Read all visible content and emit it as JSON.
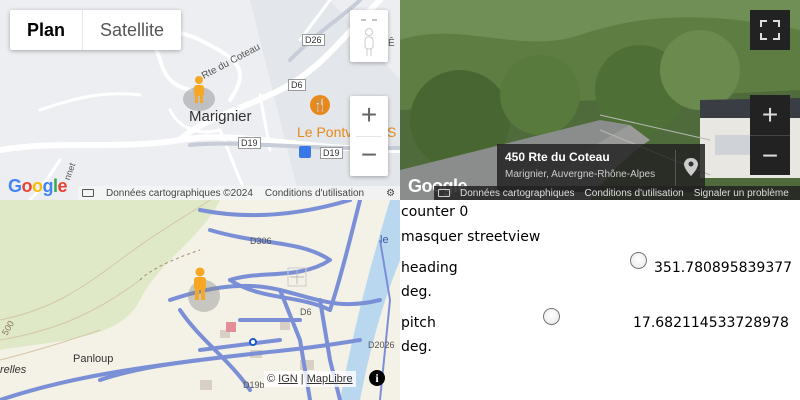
{
  "google_map": {
    "maptype": {
      "plan": "Plan",
      "satellite": "Satellite"
    },
    "zoom": {
      "in": "+",
      "out": "−"
    },
    "labels": {
      "town": "Marignier",
      "route_du_coteau": "Rte du Coteau",
      "poi": "Le Pontv",
      "poi_tail": "S",
      "road_d26": "D26",
      "road_d6": "D6",
      "road_d19a": "D19",
      "road_d19b": "D19",
      "edge_letter": "Ê",
      "nnet": "nnet"
    },
    "footer": {
      "keyboard_icon": "keyboard-icon",
      "data": "Données cartographiques ©2024",
      "terms": "Conditions d'utilisation"
    },
    "logo": "Google"
  },
  "street_view": {
    "card": {
      "title": "450 Rte du Coteau",
      "subtitle": "Marignier, Auvergne-Rhône-Alpes"
    },
    "zoom": {
      "in": "+",
      "out": "−"
    },
    "footer": {
      "data": "Données cartographiques",
      "terms": "Conditions d'utilisation",
      "report": "Signaler un problème"
    },
    "logo": "Google"
  },
  "topo_map": {
    "labels": {
      "d306": "D306",
      "d6": "D6",
      "d2026": "D2026",
      "d19b": "D19b",
      "panloup": "Panloup",
      "relles": "relles",
      "alt": "500",
      "le": "le"
    },
    "attribution": {
      "prefix": "©",
      "ign": "IGN",
      "sep": "|",
      "maplibre": "MapLibre"
    },
    "info": "i"
  },
  "controls": {
    "counter": "counter 0",
    "toggle_streetview": "masquer streetview",
    "heading_label": "heading",
    "heading_value": "351.780895839377",
    "heading_unit": "deg.",
    "pitch_label": "pitch",
    "pitch_value": "17.682114533728978",
    "pitch_unit": "deg."
  },
  "colors": {
    "road_major": "#9ca7c4",
    "topo_road": "#7b8fd6",
    "pegman": "#f6a723",
    "poi_orange": "#e8891a"
  }
}
